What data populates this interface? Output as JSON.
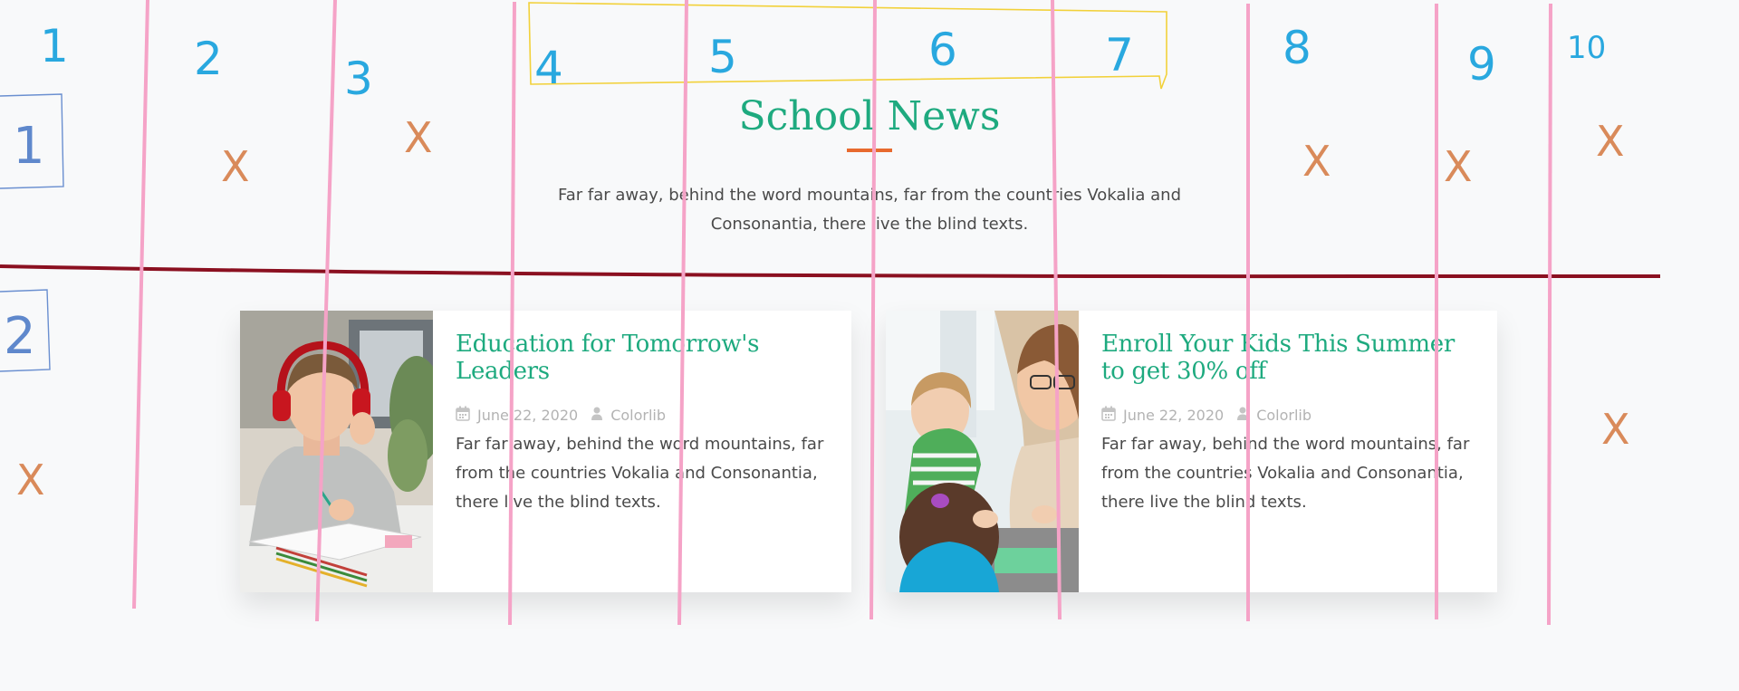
{
  "section": {
    "title": "School News",
    "intro": "Far far away, behind the word mountains, far from the countries Vokalia and Consonantia, there live the blind texts."
  },
  "posts": [
    {
      "title": "Education for Tomorrow's Leaders",
      "date": "June 22, 2020",
      "author": "Colorlib",
      "excerpt": "Far far away, behind the word mountains, far from the countries Vokalia and Consonantia, there live the blind texts."
    },
    {
      "title": "Enroll Your Kids This Summer to get 30% off",
      "date": "June 22, 2020",
      "author": "Colorlib",
      "excerpt": "Far far away, behind the word mountains, far from the countries Vokalia and Consonantia, there live the blind texts."
    }
  ],
  "annotations": {
    "columns": [
      "1",
      "2",
      "3",
      "4",
      "5",
      "6",
      "7",
      "8",
      "9",
      "10"
    ],
    "rows": [
      "1",
      "2"
    ],
    "mark": "X",
    "colors": {
      "grid_line": "#f5a3c7",
      "divider": "#8b1020",
      "digits": "#29a8df",
      "highlight": "#f2d13a",
      "cross": "#d98a5a"
    }
  },
  "icons": {
    "date": "calendar-icon",
    "author": "user-icon"
  }
}
